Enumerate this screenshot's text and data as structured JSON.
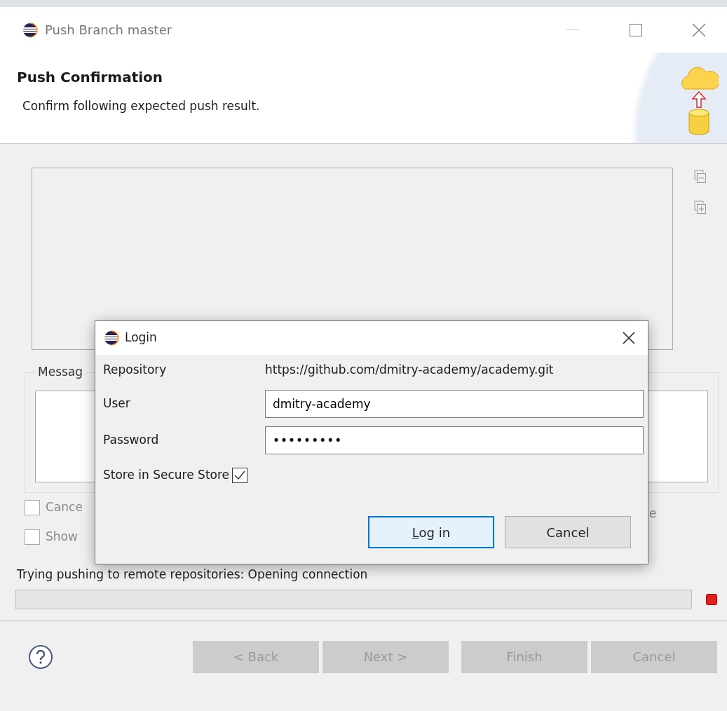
{
  "window": {
    "title": "Push Branch master"
  },
  "header": {
    "title": "Push Confirmation",
    "subtitle": "Confirm following expected push result."
  },
  "message_group": {
    "label": "Messag"
  },
  "options": [
    {
      "label": "Cance",
      "checked": false
    },
    {
      "label": "Show",
      "checked": false
    }
  ],
  "hidden_text": "e",
  "status": {
    "text": "Trying pushing to remote repositories: Opening connection"
  },
  "footer_buttons": [
    {
      "label": "< Back",
      "disabled": true
    },
    {
      "label": "Next >",
      "disabled": true
    },
    {
      "label": "Finish",
      "disabled": true
    },
    {
      "label": "Cancel",
      "disabled": true
    }
  ],
  "login": {
    "title": "Login",
    "repository": {
      "label": "Repository",
      "value": "https://github.com/dmitry-academy/academy.git"
    },
    "user": {
      "label": "User",
      "value": "dmitry-academy"
    },
    "password": {
      "label": "Password",
      "value": "•••••••••"
    },
    "store": {
      "label": "Store in Secure Store",
      "checked": true
    },
    "buttons": [
      {
        "label": "Log in",
        "default": true,
        "access_key": true
      },
      {
        "label": "Cancel",
        "default": false,
        "access_key": false
      }
    ]
  }
}
